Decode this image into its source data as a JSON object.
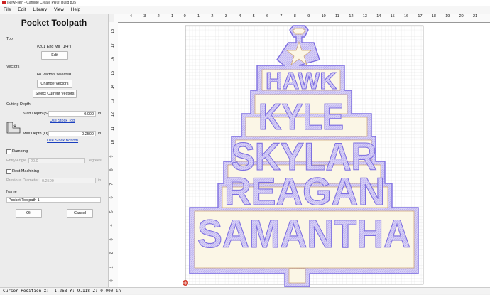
{
  "window": {
    "title": "[NewFile]* - Carbide Create PRO: Build 805"
  },
  "menu": [
    "File",
    "Edit",
    "Library",
    "View",
    "Help"
  ],
  "panel": {
    "title": "Pocket Toolpath",
    "tool": {
      "heading": "Tool",
      "name": "#201 End Mill (1/4\")",
      "edit_label": "Edit"
    },
    "vectors": {
      "heading": "Vectors",
      "count_text": "68 Vectors selected",
      "change_label": "Change Vectors",
      "select_current_label": "Select Current Vectors"
    },
    "cutting_depth": {
      "heading": "Cutting Depth",
      "start_label": "Start Depth (S)",
      "start_value": "0.000",
      "start_unit": "in",
      "use_stock_top": "Use Stock Top",
      "max_label": "Max Depth (D)",
      "max_value": "0.2500",
      "max_unit": "in",
      "use_stock_bottom": "Use Stock Bottom"
    },
    "ramping": {
      "label": "Ramping",
      "checked": false,
      "entry_angle_label": "Entry Angle",
      "entry_angle_value": "20.0",
      "entry_angle_unit": "Degrees"
    },
    "rest_machining": {
      "label": "Rest Machining",
      "checked": false,
      "prev_diameter_label": "Previous Diameter",
      "prev_diameter_value": "0.2500",
      "prev_diameter_unit": "in"
    },
    "name": {
      "heading": "Name",
      "value": "Pocket Toolpath 1"
    },
    "ok_label": "Ok",
    "cancel_label": "Cancel"
  },
  "ruler": {
    "top_ticks": [
      "-4",
      "-3",
      "-2",
      "-1",
      "0",
      "1",
      "2",
      "3",
      "4",
      "5",
      "6",
      "7",
      "8",
      "9",
      "10",
      "11",
      "12",
      "13",
      "14",
      "15",
      "16",
      "17",
      "18",
      "19",
      "20",
      "21"
    ],
    "left_ticks": [
      "18",
      "17",
      "16",
      "15",
      "14",
      "13",
      "12",
      "11",
      "10",
      "9",
      "8",
      "7",
      "6",
      "5",
      "4",
      "3",
      "2",
      "1",
      "0"
    ]
  },
  "design": {
    "words": [
      "HAWK",
      "KYLE",
      "SKYLAR",
      "REAGAN",
      "SAMANTHA"
    ],
    "outline_color": "#7d6ee0",
    "fill_color": "#d8d2f7",
    "stock_grid_color": "#c9c9c9"
  },
  "status": {
    "text": "Cursor Position X: -1.268 Y: 9.118 Z: 0.000 in"
  }
}
